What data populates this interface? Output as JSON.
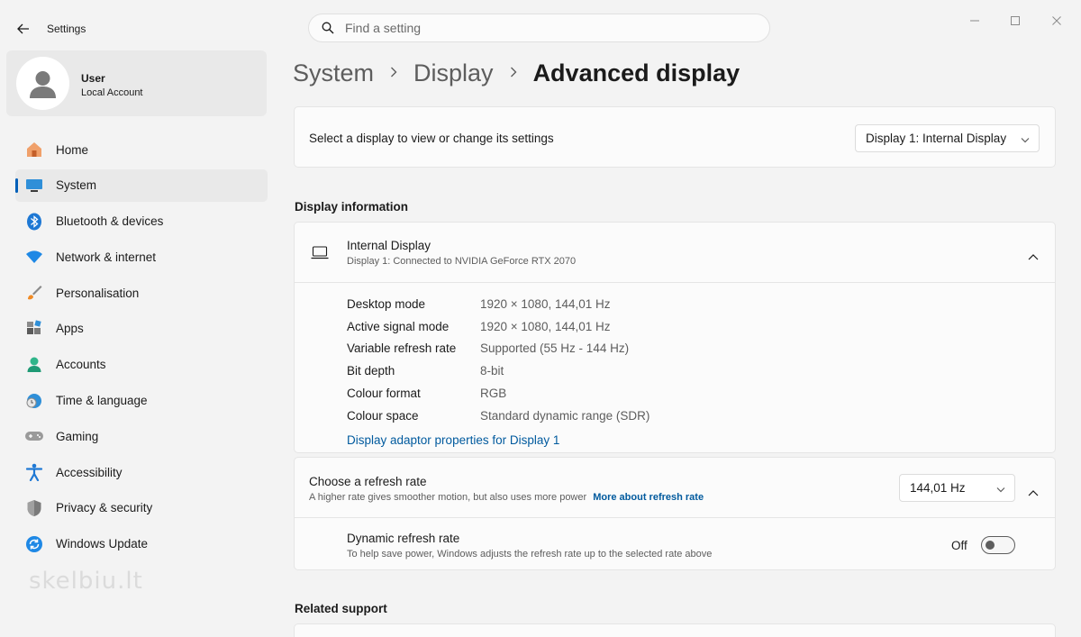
{
  "app": {
    "title": "Settings",
    "search_placeholder": "Find a setting"
  },
  "user": {
    "name": "User",
    "account": "Local Account"
  },
  "sidebar": {
    "items": [
      {
        "label": "Home",
        "icon": "home-icon",
        "active": false
      },
      {
        "label": "System",
        "icon": "monitor-icon",
        "active": true
      },
      {
        "label": "Bluetooth & devices",
        "icon": "bluetooth-icon",
        "active": false
      },
      {
        "label": "Network & internet",
        "icon": "wifi-icon",
        "active": false
      },
      {
        "label": "Personalisation",
        "icon": "paintbrush-icon",
        "active": false
      },
      {
        "label": "Apps",
        "icon": "apps-icon",
        "active": false
      },
      {
        "label": "Accounts",
        "icon": "person-icon",
        "active": false
      },
      {
        "label": "Time & language",
        "icon": "globe-clock-icon",
        "active": false
      },
      {
        "label": "Gaming",
        "icon": "gamepad-icon",
        "active": false
      },
      {
        "label": "Accessibility",
        "icon": "accessibility-icon",
        "active": false
      },
      {
        "label": "Privacy & security",
        "icon": "shield-icon",
        "active": false
      },
      {
        "label": "Windows Update",
        "icon": "update-icon",
        "active": false
      }
    ]
  },
  "watermark": "skelbiu.lt",
  "breadcrumb": {
    "level1": "System",
    "level2": "Display",
    "current": "Advanced display"
  },
  "select_display": {
    "label": "Select a display to view or change its settings",
    "value": "Display 1: Internal Display"
  },
  "display_info": {
    "section_title": "Display information",
    "name": "Internal Display",
    "subtitle": "Display 1: Connected to NVIDIA GeForce RTX 2070",
    "rows": [
      {
        "key": "Desktop mode",
        "value": "1920 × 1080, 144,01 Hz"
      },
      {
        "key": "Active signal mode",
        "value": "1920 × 1080, 144,01 Hz"
      },
      {
        "key": "Variable refresh rate",
        "value": "Supported (55 Hz - 144 Hz)"
      },
      {
        "key": "Bit depth",
        "value": "8-bit"
      },
      {
        "key": "Colour format",
        "value": "RGB"
      },
      {
        "key": "Colour space",
        "value": "Standard dynamic range (SDR)"
      }
    ],
    "adapter_link": "Display adaptor properties for Display 1"
  },
  "refresh": {
    "title": "Choose a refresh rate",
    "subtitle": "A higher rate gives smoother motion, but also uses more power",
    "more_link": "More about refresh rate",
    "value": "144,01 Hz",
    "dynamic_title": "Dynamic refresh rate",
    "dynamic_subtitle": "To help save power, Windows adjusts the refresh rate up to the selected rate above",
    "dynamic_state": "Off"
  },
  "related": {
    "section_title": "Related support"
  },
  "colors": {
    "accent": "#005fb8",
    "link": "#005a9e",
    "background": "#f3f3f3",
    "card": "#fbfbfb"
  }
}
